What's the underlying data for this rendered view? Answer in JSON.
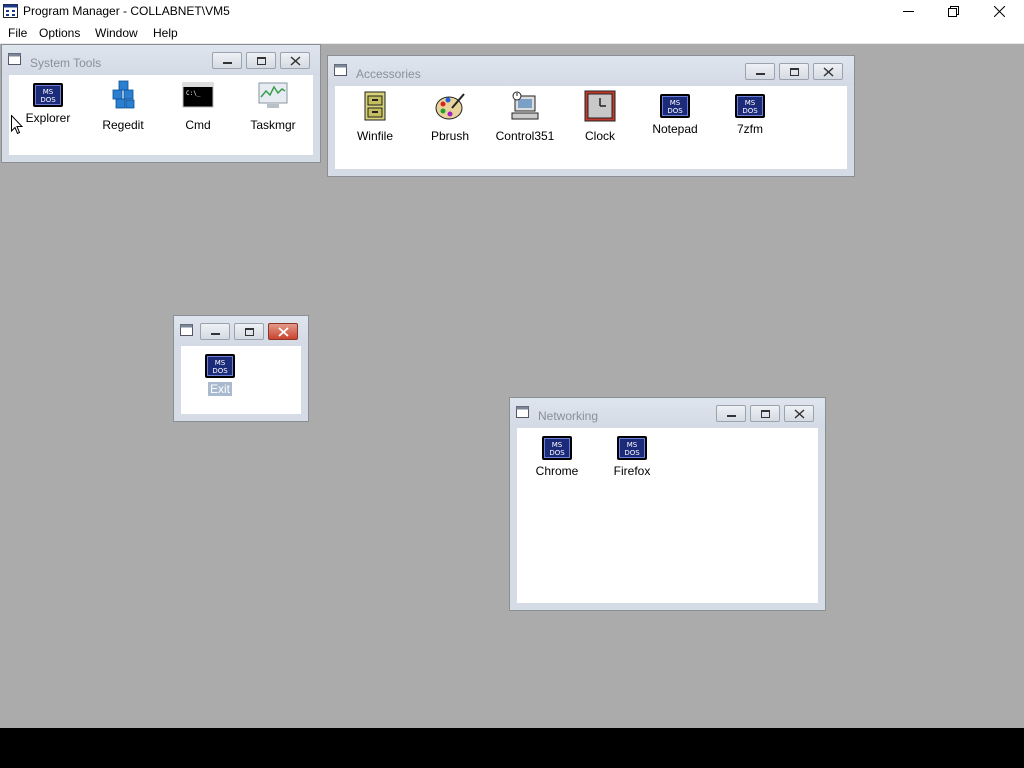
{
  "window": {
    "title": "Program Manager - COLLABNET\\VM5"
  },
  "menu": [
    "File",
    "Options",
    "Window",
    "Help"
  ],
  "groups": {
    "system_tools": {
      "title": "System Tools",
      "items": [
        "Explorer",
        "Regedit",
        "Cmd",
        "Taskmgr"
      ]
    },
    "accessories": {
      "title": "Accessories",
      "items": [
        "Winfile",
        "Pbrush",
        "Control351",
        "Clock",
        "Notepad",
        "7zfm"
      ]
    },
    "untitled": {
      "title": "",
      "items": [
        "Exit"
      ]
    },
    "networking": {
      "title": "Networking",
      "items": [
        "Chrome",
        "Firefox"
      ]
    }
  },
  "msdos_text": "MS DOS",
  "colors": {
    "desktop": "#ababab",
    "group_frame": "#d6dce6",
    "close_active": "#c9442e",
    "msdos_blue": "#1c2a7a"
  }
}
